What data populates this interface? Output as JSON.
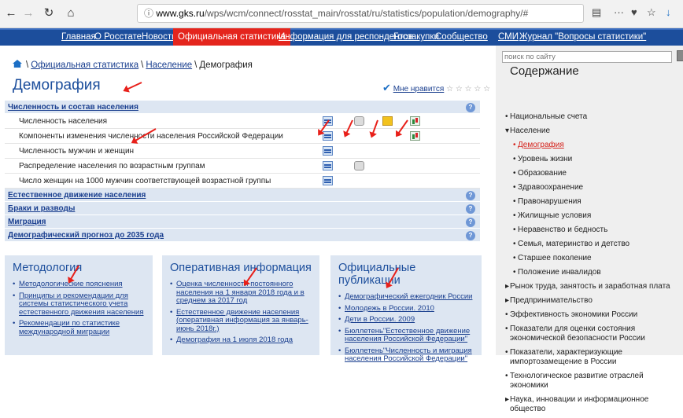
{
  "browser": {
    "url_host": "www.gks.ru",
    "url_path": "/wps/wcm/connect/rosstat_main/rosstat/ru/statistics/population/demography/#",
    "icons": [
      "back-icon",
      "forward-icon",
      "reload-icon",
      "home-icon",
      "info-icon",
      "reader-icon",
      "more-icon",
      "pocket-icon",
      "bookmark-star-icon",
      "download-icon",
      "library-icon",
      "sidebar-icon"
    ]
  },
  "topnav": {
    "items": [
      "Главная",
      "О Росстате",
      "Новости",
      "Официальная статистика",
      "Информация для респондентов",
      "Госзакупки",
      "Сообщество",
      "СМИ",
      "Журнал \"Вопросы статистики\""
    ],
    "active": "Официальная статистика",
    "colors": {
      "bar": "#1c4e9c",
      "active": "#e4251d"
    }
  },
  "breadcrumb": {
    "items": [
      "Официальная статистика",
      "Население",
      "Демография"
    ],
    "sep": "\\"
  },
  "page": {
    "title": "Демография",
    "like": "Мне нравится",
    "stars": "☆ ☆ ☆ ☆ ☆"
  },
  "sections": [
    {
      "title": "Численность и состав населения",
      "rows": [
        "Численность населения",
        "Компоненты изменения численности населения Российской Федерации",
        "Численность мужчин и женщин",
        "Распределение населения по возрастным группам",
        "Число женщин на 1000 мужчин соответствующей возрастной группы"
      ]
    },
    {
      "title": "Естественное движение населения"
    },
    {
      "title": "Браки и разводы"
    },
    {
      "title": "Миграция"
    },
    {
      "title": "Демографический прогноз до 2035 года"
    }
  ],
  "boxes": [
    {
      "title": "Методология",
      "items": [
        "Методологические пояснения",
        "Принципы и рекомендации для системы статистического учета естественного движения населения",
        "Рекомендации по статистике международной миграции"
      ]
    },
    {
      "title": "Оперативная информация",
      "items": [
        "Оценка численности постоянного населения на 1 января 2018 года и в среднем за 2017 год",
        "Естественное движение населения (оперативная информация за январь-июнь 2018г.)",
        "Демография на 1 июля 2018 года"
      ]
    },
    {
      "title": "Официальные публикации",
      "items": [
        "Демографический ежегодник России",
        "Молодежь в России. 2010",
        "Дети в России. 2009",
        "Бюллетень\"Естественное движение населения Российской Федерации\"",
        "Бюллетень\"Численность и миграция населения Российской Федерации\""
      ]
    }
  ],
  "sidebar": {
    "search_placeholder": "поиск по сайту",
    "title": "Содержание",
    "items": [
      {
        "t": "Национальные счета",
        "k": "b",
        "i": 0
      },
      {
        "t": "Население",
        "k": "o",
        "i": 0
      },
      {
        "t": "Демография",
        "k": "b",
        "i": 1,
        "red": true
      },
      {
        "t": "Уровень жизни",
        "k": "b",
        "i": 1
      },
      {
        "t": "Образование",
        "k": "b",
        "i": 1
      },
      {
        "t": "Здравоохранение",
        "k": "b",
        "i": 1
      },
      {
        "t": "Правонарушения",
        "k": "b",
        "i": 1
      },
      {
        "t": "Жилищные условия",
        "k": "b",
        "i": 1
      },
      {
        "t": "Неравенство и бедность",
        "k": "b",
        "i": 1
      },
      {
        "t": "Семья, материнство и детство",
        "k": "b",
        "i": 1
      },
      {
        "t": "Старшее поколение",
        "k": "b",
        "i": 1
      },
      {
        "t": "Положение инвалидов",
        "k": "b",
        "i": 1
      },
      {
        "t": "Рынок труда, занятость и заработная плата",
        "k": "e",
        "i": 0
      },
      {
        "t": "Предпринимательство",
        "k": "e",
        "i": 0
      },
      {
        "t": "Эффективность экономики России",
        "k": "b",
        "i": 0
      },
      {
        "t": "Показатели для оценки состояния экономической безопасности России",
        "k": "b",
        "i": 0
      },
      {
        "t": "Показатели, характеризующие импортозамещение в России",
        "k": "b",
        "i": 0
      },
      {
        "t": "Технологическое развитие отраслей экономики",
        "k": "b",
        "i": 0
      },
      {
        "t": "Наука, инновации и информационное общество",
        "k": "e",
        "i": 0
      }
    ]
  }
}
